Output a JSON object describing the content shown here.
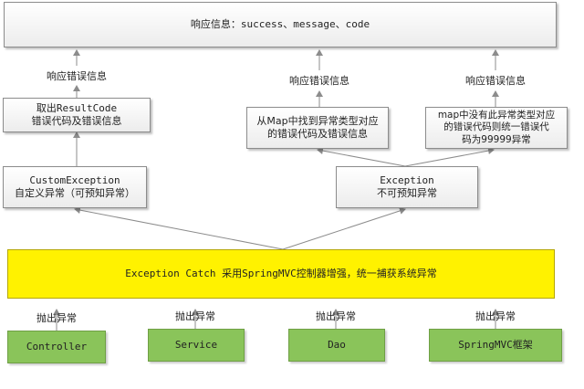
{
  "top": {
    "text": "响应信息：success、message、code"
  },
  "labels": {
    "resp_left": "响应错误信息",
    "resp_mid": "响应错误信息",
    "resp_right": "响应错误信息"
  },
  "boxes": {
    "result_code": {
      "line1": "取出ResultCode",
      "line2": "错误代码及错误信息"
    },
    "map_found": {
      "line1": "从Map中找到异常类型对应",
      "line2": "的错误代码及错误信息"
    },
    "map_missing": {
      "line1": "map中没有此异常类型对应",
      "line2": "的错误代码则统一错误代",
      "line3": "码为99999异常"
    },
    "custom_exception": {
      "line1": "CustomException",
      "line2": "自定义异常（可预知异常）"
    },
    "exception": {
      "line1": "Exception",
      "line2": "不可预知异常"
    },
    "catch_bar": {
      "text": "Exception Catch 采用SpringMVC控制器增强，统一捕获系统异常"
    }
  },
  "throw_labels": [
    "抛出异常",
    "抛出异常",
    "抛出异常",
    "抛出异常"
  ],
  "sources": [
    "Controller",
    "Service",
    "Dao",
    "SpringMVC框架"
  ],
  "colors": {
    "grey_box": "#f2f2f2",
    "yellow_bar": "#fff200",
    "green_box": "#8ac45a",
    "arrow": "#8c8c8c"
  }
}
